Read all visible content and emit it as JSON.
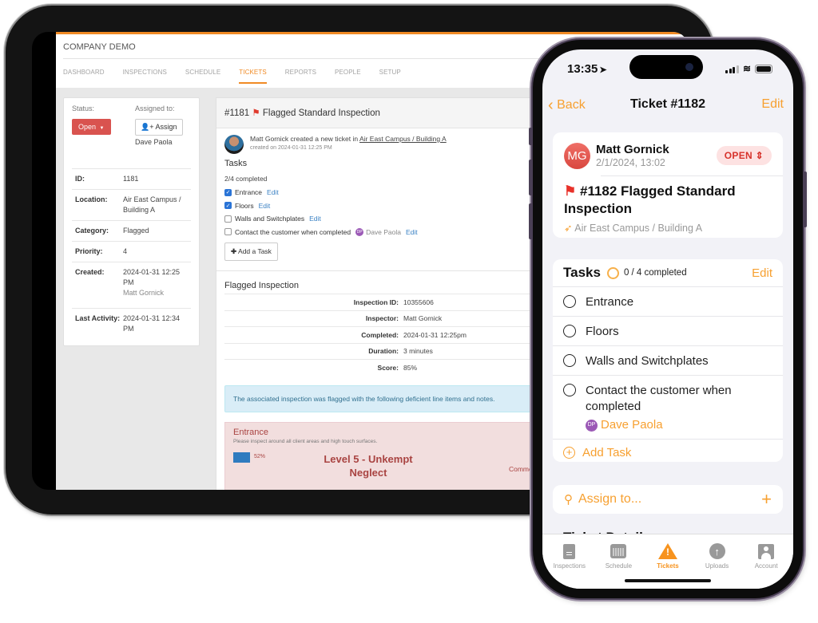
{
  "web": {
    "company": "COMPANY DEMO",
    "nav": [
      "DASHBOARD",
      "INSPECTIONS",
      "SCHEDULE",
      "TICKETS",
      "REPORTS",
      "PEOPLE",
      "SETUP"
    ],
    "active_nav": "TICKETS",
    "accent": "#f08a24",
    "side": {
      "status_label": "Status:",
      "status_value": "Open",
      "assigned_label": "Assigned to:",
      "assign_button": "Assign",
      "assignee": "Dave Paola",
      "fields": [
        {
          "k": "ID:",
          "v": "1181",
          "sub": ""
        },
        {
          "k": "Location:",
          "v": "Air East Campus / Building A",
          "sub": ""
        },
        {
          "k": "Category:",
          "v": "Flagged",
          "sub": ""
        },
        {
          "k": "Priority:",
          "v": "4",
          "sub": ""
        },
        {
          "k": "Created:",
          "v": "2024-01-31 12:25 PM",
          "sub": "Matt Gornick"
        },
        {
          "k": "Last Activity:",
          "v": "2024-01-31 12:34 PM",
          "sub": ""
        }
      ]
    },
    "main": {
      "ticket_number": "#1181",
      "ticket_title": "Flagged Standard Inspection",
      "creator_text": "Matt Gornick created a new ticket in",
      "creator_link": "Air East Campus / Building A",
      "created_on": "created on 2024-01-31 12:25 PM",
      "tasks_title": "Tasks",
      "tasks_count": "2/4 completed",
      "tasks": [
        {
          "label": "Entrance",
          "checked": true,
          "assignee": "",
          "edit": "Edit"
        },
        {
          "label": "Floors",
          "checked": true,
          "assignee": "",
          "edit": "Edit"
        },
        {
          "label": "Walls and Switchplates",
          "checked": false,
          "assignee": "",
          "edit": "Edit"
        },
        {
          "label": "Contact the customer when completed",
          "checked": false,
          "assignee": "Dave Paola",
          "assignee_initials": "DP",
          "edit": "Edit"
        }
      ],
      "add_task": "Add a Task",
      "inspection_title": "Flagged Inspection",
      "inspection": [
        {
          "k": "Inspection ID:",
          "v": "10355606"
        },
        {
          "k": "Inspector:",
          "v": "Matt Gornick"
        },
        {
          "k": "Completed:",
          "v": "2024-01-31 12:25pm"
        },
        {
          "k": "Duration:",
          "v": "3 minutes"
        },
        {
          "k": "Score:",
          "v": "85%"
        }
      ],
      "alert": "The associated inspection was flagged with the following deficient line items and notes.",
      "deficient": {
        "title": "Entrance",
        "description": "Please inspect around all client areas and high touch surfaces.",
        "percent": "52%",
        "level": "Level 5 - Unkempt Neglect",
        "comments": "Comments ar"
      }
    }
  },
  "mobile": {
    "time": "13:35",
    "back": "Back",
    "title": "Ticket #1182",
    "edit": "Edit",
    "accent": "#f7a030",
    "ticket": {
      "initials": "MG",
      "author": "Matt Gornick",
      "date": "2/1/2024, 13:02",
      "status": "OPEN",
      "title": "#1182 Flagged Standard Inspection",
      "location": "Air East Campus / Building A"
    },
    "tasks": {
      "title": "Tasks",
      "count": "0 / 4 completed",
      "edit": "Edit",
      "items": [
        {
          "label": "Entrance",
          "assignee": ""
        },
        {
          "label": "Floors",
          "assignee": ""
        },
        {
          "label": "Walls and Switchplates",
          "assignee": ""
        },
        {
          "label": "Contact the customer when completed",
          "assignee": "Dave Paola",
          "assignee_initials": "DP"
        }
      ],
      "add": "Add Task"
    },
    "assign": "Assign to...",
    "details_peek": "Ticket Details",
    "tabs": [
      {
        "label": "Inspections",
        "icon": "document-icon",
        "active": false
      },
      {
        "label": "Schedule",
        "icon": "calendar-icon",
        "active": false
      },
      {
        "label": "Tickets",
        "icon": "warning-icon",
        "active": true
      },
      {
        "label": "Uploads",
        "icon": "upload-icon",
        "active": false
      },
      {
        "label": "Account",
        "icon": "account-icon",
        "active": false
      }
    ]
  }
}
